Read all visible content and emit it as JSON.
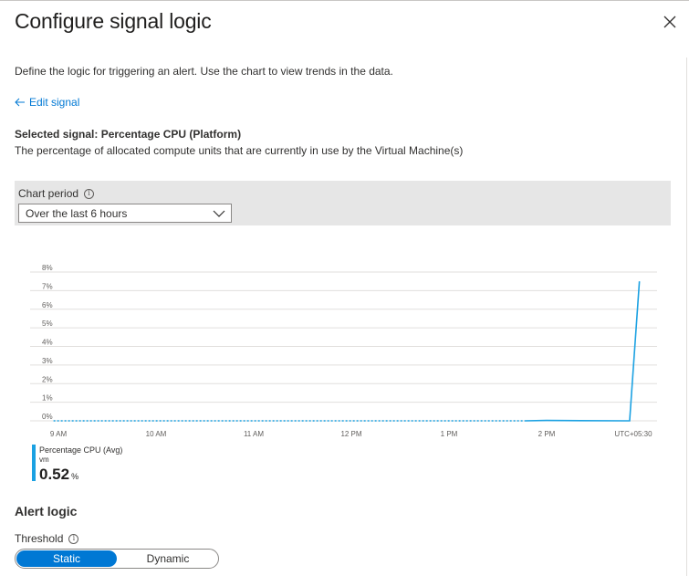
{
  "panel": {
    "title": "Configure signal logic",
    "intro": "Define the logic for triggering an alert. Use the chart to view trends in the data.",
    "edit_signal": "Edit signal",
    "selected_signal": "Selected signal: Percentage CPU (Platform)",
    "signal_description": "The percentage of allocated compute units that are currently in use by the Virtual Machine(s)"
  },
  "chart_period": {
    "label": "Chart period",
    "selected": "Over the last 6 hours"
  },
  "chart_data": {
    "type": "line",
    "y_ticks": [
      "0%",
      "1%",
      "2%",
      "3%",
      "4%",
      "5%",
      "6%",
      "7%",
      "8%"
    ],
    "ylim": [
      0,
      8
    ],
    "x_ticks": [
      "9 AM",
      "10 AM",
      "11 AM",
      "12 PM",
      "1 PM",
      "2 PM",
      "UTC+05:30"
    ],
    "grid": true,
    "series": [
      {
        "name": "Percentage CPU (Avg)",
        "color": "#1ba1e2",
        "dotted_segment": {
          "x": [
            8.95,
            13.78
          ],
          "y": [
            0.0,
            0.0
          ]
        },
        "solid_segment": {
          "x": [
            13.78,
            14.0,
            14.8,
            14.85,
            14.95
          ],
          "y": [
            0.0,
            0.02,
            0.0,
            0.0,
            7.5
          ]
        }
      }
    ]
  },
  "legend": {
    "name": "Percentage CPU (Avg)",
    "resource": "vm",
    "value": "0.52",
    "unit": "%"
  },
  "alert_logic": {
    "heading": "Alert logic",
    "threshold_label": "Threshold",
    "options": [
      "Static",
      "Dynamic"
    ],
    "selected": "Static"
  }
}
